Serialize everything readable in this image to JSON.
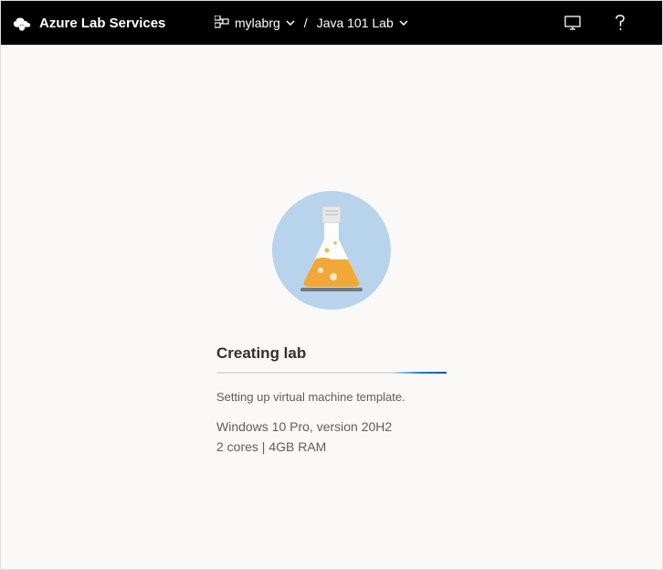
{
  "header": {
    "appTitle": "Azure Lab Services",
    "resourceGroup": "mylabrg",
    "labName": "Java 101 Lab"
  },
  "main": {
    "title": "Creating lab",
    "status": "Setting up virtual machine template.",
    "osLine": "Windows 10 Pro, version 20H2",
    "hwLine": "2 cores | 4GB RAM"
  }
}
